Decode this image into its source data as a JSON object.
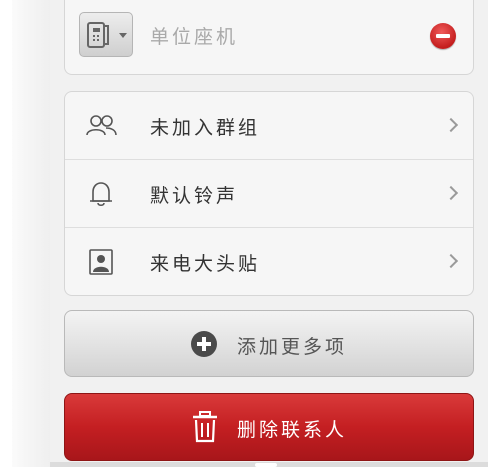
{
  "phone_entry": {
    "type_label": "单位座机",
    "type_icon": "office-phone-icon",
    "remove_icon": "minus-circle-icon"
  },
  "menu": {
    "items": [
      {
        "label": "未加入群组",
        "icon": "people-icon"
      },
      {
        "label": "默认铃声",
        "icon": "bell-icon"
      },
      {
        "label": "来电大头贴",
        "icon": "portrait-icon"
      }
    ]
  },
  "actions": {
    "add_more_label": "添加更多项",
    "delete_contact_label": "删除联系人"
  },
  "colors": {
    "delete_red": "#c41f22",
    "remove_red": "#d93030"
  }
}
